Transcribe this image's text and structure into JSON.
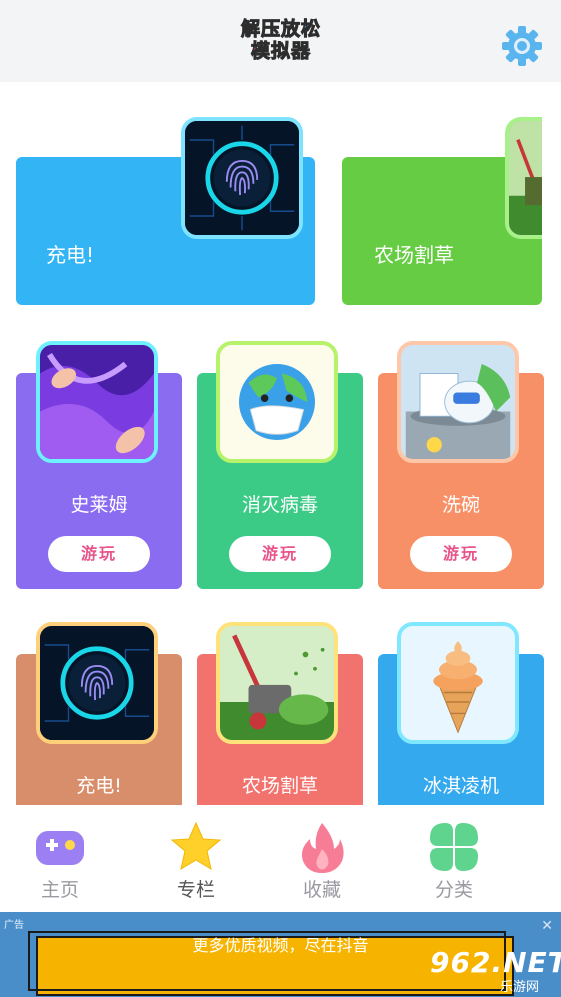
{
  "header": {
    "logo_line1": [
      "解",
      "压",
      "放",
      "松"
    ],
    "logo_line2": [
      "模",
      "拟",
      "器"
    ],
    "settings_icon": "gear-icon"
  },
  "featured": [
    {
      "title": "充电!",
      "color": "#33b5f5",
      "icon": "fingerprint-icon"
    },
    {
      "title": "农场割草",
      "color": "#66cc44",
      "icon": "lawnmower-icon"
    }
  ],
  "games_row1": [
    {
      "title": "史莱姆",
      "play": "游玩",
      "color": "#8a6cf0",
      "icon": "slime-icon"
    },
    {
      "title": "消灭病毒",
      "play": "游玩",
      "color": "#3ccb87",
      "icon": "earth-mask-icon"
    },
    {
      "title": "洗碗",
      "play": "游玩",
      "color": "#f79066",
      "icon": "dishwashing-icon"
    }
  ],
  "games_row2": [
    {
      "title": "充电!",
      "color": "#d88e6a",
      "icon": "fingerprint-icon"
    },
    {
      "title": "农场割草",
      "color": "#f2736e",
      "icon": "lawnmower-icon"
    },
    {
      "title": "冰淇凌机",
      "color": "#34a9ee",
      "icon": "ice-cream-icon"
    }
  ],
  "nav": [
    {
      "label": "主页",
      "icon": "gamepad-icon"
    },
    {
      "label": "专栏",
      "icon": "star-icon"
    },
    {
      "label": "收藏",
      "icon": "flame-icon"
    },
    {
      "label": "分类",
      "icon": "clover-icon"
    }
  ],
  "ad": {
    "tag": "广告",
    "close": "✕",
    "slogan": "更多优质视频，尽在抖音"
  },
  "watermark": {
    "brand": "962.NET",
    "sub": "乐游网"
  }
}
